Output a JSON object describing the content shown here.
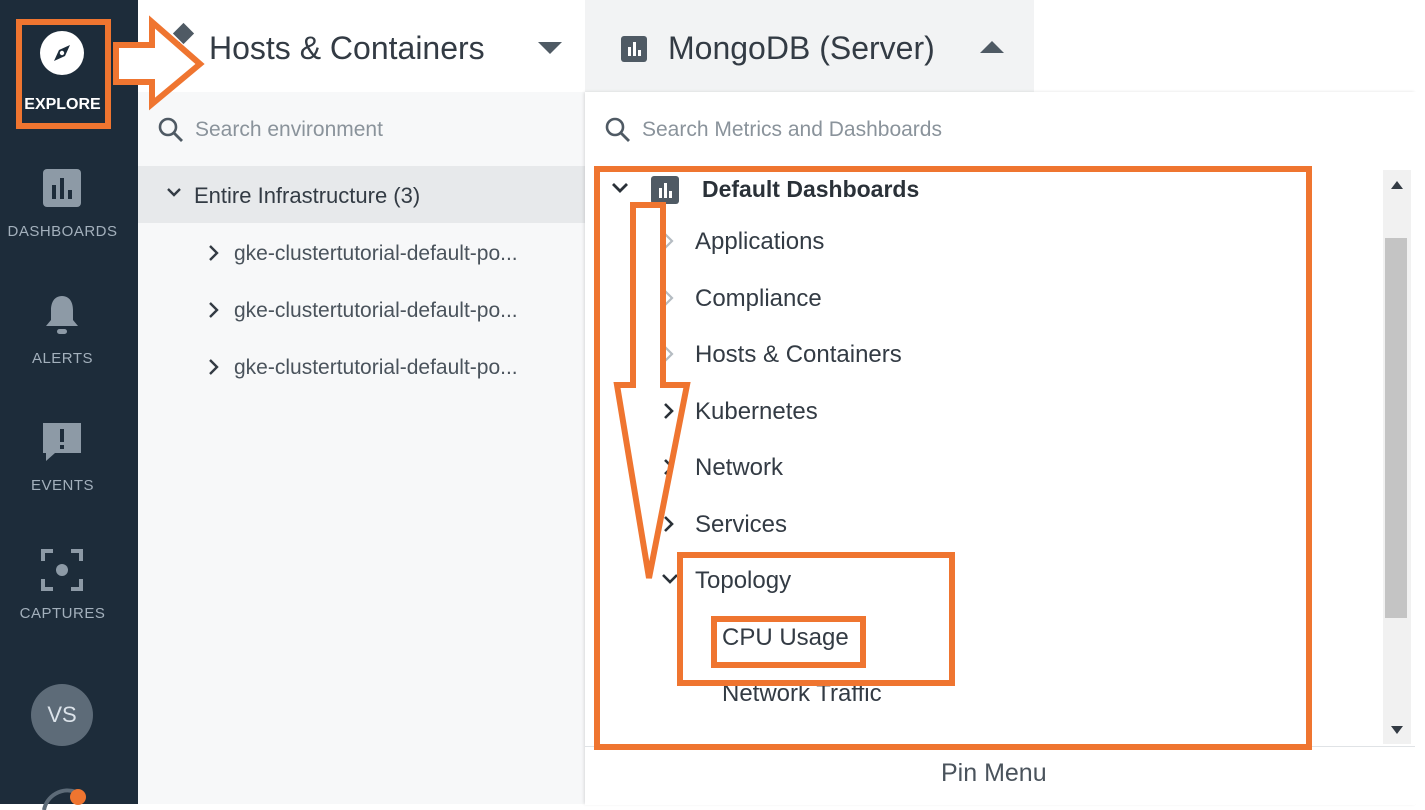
{
  "nav": {
    "items": [
      {
        "label": "EXPLORE",
        "icon": "compass-icon",
        "active": true
      },
      {
        "label": "DASHBOARDS",
        "icon": "bar-chart-icon"
      },
      {
        "label": "ALERTS",
        "icon": "bell-icon"
      },
      {
        "label": "EVENTS",
        "icon": "exclamation-message-icon"
      },
      {
        "label": "CAPTURES",
        "icon": "capture-frame-icon"
      }
    ],
    "avatar_initials": "VS"
  },
  "header": {
    "scope_tab": {
      "label": "Hosts & Containers",
      "icon": "cubes-icon"
    },
    "dashboard_tab": {
      "label": "MongoDB (Server)",
      "icon": "dashboard-chart-icon"
    }
  },
  "tree": {
    "search_placeholder": "Search environment",
    "root_label": "Entire Infrastructure (3)",
    "nodes": [
      {
        "label": "gke-clustertutorial-default-po..."
      },
      {
        "label": "gke-clustertutorial-default-po..."
      },
      {
        "label": "gke-clustertutorial-default-po..."
      }
    ]
  },
  "dashboards": {
    "search_placeholder": "Search Metrics and Dashboards",
    "group_label": "Default Dashboards",
    "items": [
      {
        "label": "Applications",
        "expanded": false
      },
      {
        "label": "Compliance",
        "expanded": false
      },
      {
        "label": "Hosts & Containers",
        "expanded": false
      },
      {
        "label": "Kubernetes",
        "expanded": false
      },
      {
        "label": "Network",
        "expanded": false
      },
      {
        "label": "Services",
        "expanded": false
      },
      {
        "label": "Topology",
        "expanded": true
      }
    ],
    "sub_items": [
      {
        "label": "CPU Usage",
        "highlighted": true
      },
      {
        "label": "Network Traffic"
      }
    ],
    "pin_menu_label": "Pin Menu"
  },
  "colors": {
    "rail_bg": "#1d2c3a",
    "highlight": "#ef7530",
    "active_tab_bg": "#f2f3f4"
  }
}
